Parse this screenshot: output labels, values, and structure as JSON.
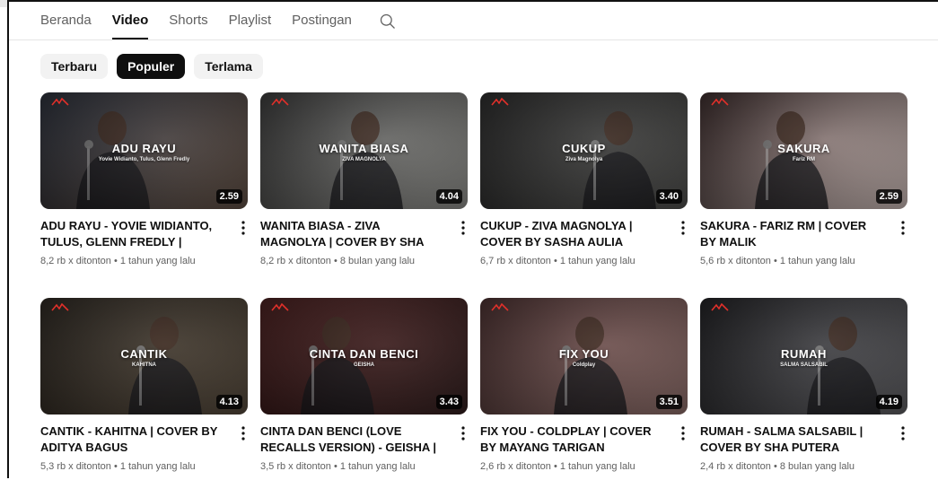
{
  "tabs": [
    {
      "label": "Beranda",
      "active": false
    },
    {
      "label": "Video",
      "active": true
    },
    {
      "label": "Shorts",
      "active": false
    },
    {
      "label": "Playlist",
      "active": false
    },
    {
      "label": "Postingan",
      "active": false
    }
  ],
  "chips": [
    {
      "label": "Terbaru",
      "active": false
    },
    {
      "label": "Populer",
      "active": true
    },
    {
      "label": "Terlama",
      "active": false
    }
  ],
  "colors": {
    "active_chip_bg": "#0f0f0f",
    "inactive_chip_bg": "#f2f2f2",
    "text_primary": "#0f0f0f",
    "text_secondary": "#606060",
    "duration_badge_bg": "#000000"
  },
  "videos": [
    {
      "title": "ADU RAYU - YOVIE WIDIANTO, TULUS, GLENN FREDLY | COVER B...",
      "stats": "8,2 rb x ditonton • 1 tahun yang lalu",
      "duration": "2.59",
      "thumb_title": "ADU RAYU",
      "thumb_sub": "Yovie Widianto, Tulus, Glenn Fredly",
      "bg": [
        "#2a2f3a",
        "#5b4a3f"
      ],
      "icon": "more-vert-icon"
    },
    {
      "title": "WANITA BIASA - ZIVA MAGNOLYA | COVER BY SHA PUTERA",
      "stats": "8,2 rb x ditonton • 8 bulan yang lalu",
      "duration": "4.04",
      "thumb_title": "WANITA BIASA",
      "thumb_sub": "ZIVA MAGNOLYA",
      "bg": [
        "#3a3a3a",
        "#8a8a86"
      ],
      "icon": "more-vert-icon"
    },
    {
      "title": "CUKUP - ZIVA MAGNOLYA | COVER BY SASHA AULIA",
      "stats": "6,7 rb x ditonton • 1 tahun yang lalu",
      "duration": "3.40",
      "thumb_title": "CUKUP",
      "thumb_sub": "Ziva Magnolya",
      "bg": [
        "#2a2a2a",
        "#4a4a48"
      ],
      "icon": "more-vert-icon"
    },
    {
      "title": "SAKURA - FARIZ RM | COVER BY MALIK",
      "stats": "5,6 rb x ditonton • 1 tahun yang lalu",
      "duration": "2.59",
      "thumb_title": "SAKURA",
      "thumb_sub": "Fariz RM",
      "bg": [
        "#3a2a2a",
        "#c7b6b2"
      ],
      "icon": "more-vert-icon"
    },
    {
      "title": "CANTIK - KAHITNA | COVER BY ADITYA BAGUS",
      "stats": "5,3 rb x ditonton • 1 tahun yang lalu",
      "duration": "4.13",
      "thumb_title": "CANTIK",
      "thumb_sub": "KAHITNA",
      "bg": [
        "#2b2620",
        "#514537"
      ],
      "icon": "more-vert-icon"
    },
    {
      "title": "CINTA DAN BENCI (LOVE RECALLS VERSION) - GEISHA | COVER BY...",
      "stats": "3,5 rb x ditonton • 1 tahun yang lalu",
      "duration": "3.43",
      "thumb_title": "CINTA DAN BENCI",
      "thumb_sub": "GEISHA",
      "bg": [
        "#4a1f1f",
        "#2e1a1a"
      ],
      "icon": "more-vert-icon"
    },
    {
      "title": "FIX YOU - COLDPLAY | COVER BY MAYANG TARIGAN",
      "stats": "2,6 rb x ditonton • 1 tahun yang lalu",
      "duration": "3.51",
      "thumb_title": "FIX YOU",
      "thumb_sub": "Coldplay",
      "bg": [
        "#4a2f2f",
        "#8a6a66"
      ],
      "icon": "more-vert-icon"
    },
    {
      "title": "RUMAH - SALMA SALSABIL | COVER BY SHA PUTERA",
      "stats": "2,4 rb x ditonton • 8 bulan yang lalu",
      "duration": "4.19",
      "thumb_title": "RUMAH",
      "thumb_sub": "SALMA SALSABIL",
      "bg": [
        "#1f1f22",
        "#5a5a5e"
      ],
      "icon": "more-vert-icon"
    }
  ]
}
